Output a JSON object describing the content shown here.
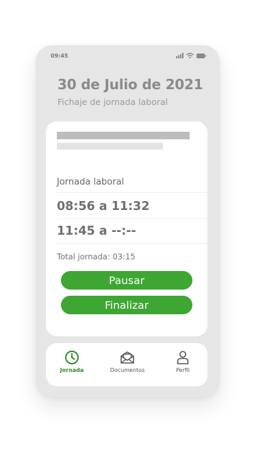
{
  "status_bar": {
    "time": "09:45",
    "icons": [
      "signal-icon",
      "wifi-icon",
      "battery-icon"
    ]
  },
  "header": {
    "date_title": "30 de Julio de 2021",
    "subtitle": "Fichaje de jornada laboral"
  },
  "card": {
    "section_label": "Jornada laboral",
    "time_ranges": [
      "08:56 a 11:32",
      "11:45 a --:--"
    ],
    "total": "Total jornada: 03:15",
    "pause_button": "Pausar",
    "finish_button": "Finalizar"
  },
  "nav": {
    "items": [
      {
        "label": "Jornada",
        "icon": "clock-icon",
        "active": true
      },
      {
        "label": "Documentos",
        "icon": "mail-icon",
        "active": false
      },
      {
        "label": "Perfil",
        "icon": "user-icon",
        "active": false
      }
    ]
  },
  "colors": {
    "accent": "#3ea632",
    "active_nav": "#2f8c27",
    "background": "#e6e6e6",
    "card": "#ffffff",
    "title_text": "#8a8a8a"
  }
}
